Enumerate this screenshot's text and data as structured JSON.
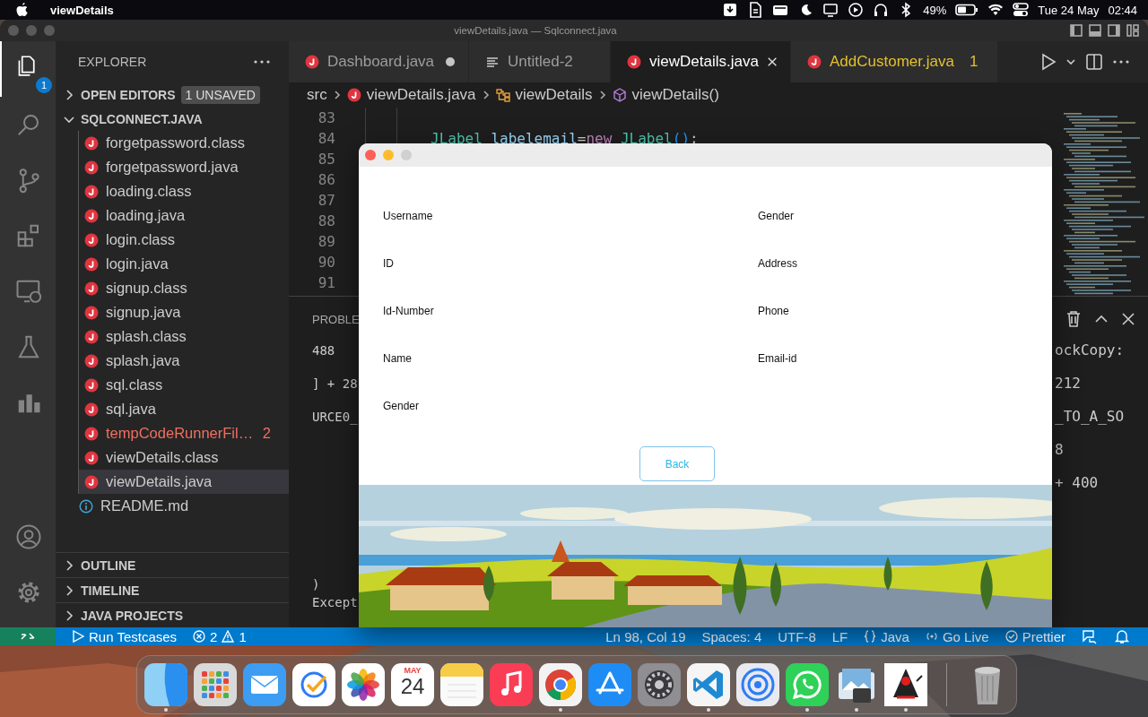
{
  "menu_bar": {
    "app": "viewDetails",
    "battery": "49%",
    "date": "Tue 24 May",
    "time": "02:44"
  },
  "window": {
    "title": "viewDetails.java — Sqlconnect.java"
  },
  "activity_bar": [
    {
      "kind": "explorer",
      "selected": true,
      "badge": "1"
    },
    {
      "kind": "search",
      "selected": false
    },
    {
      "kind": "source_control",
      "selected": false
    },
    {
      "kind": "extensions",
      "selected": false
    },
    {
      "kind": "remote",
      "selected": false
    },
    {
      "kind": "testing",
      "selected": false
    },
    {
      "kind": "chart",
      "selected": false
    }
  ],
  "activity_bar_bottom": [
    {
      "kind": "account"
    },
    {
      "kind": "settings"
    }
  ],
  "sidebar": {
    "title": "EXPLORER",
    "sections": [
      {
        "label": "OPEN EDITORS",
        "expanded": false,
        "badge": "1 UNSAVED"
      },
      {
        "label": "SQLCONNECT.JAVA",
        "expanded": true,
        "tree": [
          {
            "children": [
              {
                "label": "forgetpassword.class",
                "kind": "java",
                "selected": false
              },
              {
                "label": "forgetpassword.java",
                "kind": "java",
                "selected": false
              },
              {
                "label": "loading.class",
                "kind": "java",
                "selected": false
              },
              {
                "label": "loading.java",
                "kind": "java",
                "selected": false
              },
              {
                "label": "login.class",
                "kind": "java",
                "selected": false
              },
              {
                "label": "login.java",
                "kind": "java",
                "selected": false
              },
              {
                "label": "signup.class",
                "kind": "java",
                "selected": false
              },
              {
                "label": "signup.java",
                "kind": "java",
                "selected": false
              },
              {
                "label": "splash.class",
                "kind": "java",
                "selected": false
              },
              {
                "label": "splash.java",
                "kind": "java",
                "selected": false
              },
              {
                "label": "sql.class",
                "kind": "java",
                "selected": false
              },
              {
                "label": "sql.java",
                "kind": "java",
                "selected": false
              },
              {
                "label": "tempCodeRunnerFil…",
                "kind": "java",
                "selected": false,
                "has_errors": true,
                "problems": "2"
              },
              {
                "label": "viewDetails.class",
                "kind": "java",
                "selected": false
              },
              {
                "label": "viewDetails.java",
                "kind": "java",
                "selected": true
              }
            ]
          },
          {
            "label": "README.md",
            "kind": "info",
            "selected": false
          }
        ]
      }
    ],
    "bottom_sections": [
      {
        "label": "OUTLINE",
        "expanded": false
      },
      {
        "label": "TIMELINE",
        "expanded": false
      },
      {
        "label": "JAVA PROJECTS",
        "expanded": false
      }
    ]
  },
  "tabs": [
    {
      "label": "Dashboard.java",
      "kind": "java",
      "selected": false,
      "modified": true
    },
    {
      "label": "Untitled-2",
      "kind": "text",
      "selected": false,
      "modified": false
    },
    {
      "label": "viewDetails.java",
      "kind": "java",
      "selected": true,
      "modified": false
    },
    {
      "label": "AddCustomer.java",
      "kind": "java",
      "selected": false,
      "modified": false,
      "has_warnings": true,
      "problems": "1"
    }
  ],
  "breadcrumb": [
    {
      "label": "src",
      "kind": "folder"
    },
    {
      "label": "viewDetails.java",
      "kind": "java"
    },
    {
      "label": "viewDetails",
      "kind": "class"
    },
    {
      "label": "viewDetails()",
      "kind": "method"
    }
  ],
  "code": {
    "lines": [
      {
        "number": "83"
      },
      {
        "number": "84",
        "tokens": [
          {
            "text": "JLabel",
            "kind": "type"
          },
          {
            "text": " labelemail",
            "kind": "variable"
          },
          {
            "text": "=",
            "kind": "plain"
          },
          {
            "text": "new",
            "kind": "keyword"
          },
          {
            "text": " JLabel",
            "kind": "type"
          },
          {
            "text": "()",
            "kind": "bracket"
          },
          {
            "text": ";",
            "kind": "plain"
          }
        ]
      },
      {
        "number": "85"
      },
      {
        "number": "86"
      },
      {
        "number": "87"
      },
      {
        "number": "88"
      },
      {
        "number": "89"
      },
      {
        "number": "90"
      },
      {
        "number": "91"
      }
    ]
  },
  "panel": {
    "tab": "PROBLE",
    "left_lines": [
      "488",
      "] + 28",
      "URCE0_"
    ],
    "left_tail": [
      ")",
      "Except"
    ],
    "right_lines": [
      "ockCopy:",
      "212",
      "_TO_A_SO",
      "8",
      "+ 400"
    ]
  },
  "status_bar": {
    "run": "Run Testcases",
    "errors": "2",
    "warnings": "1",
    "items": [
      {
        "text": "Ln 98, Col 19",
        "kind": "plain"
      },
      {
        "text": "Spaces: 4",
        "kind": "plain"
      },
      {
        "text": "UTF-8",
        "kind": "plain"
      },
      {
        "text": "LF",
        "kind": "plain"
      },
      {
        "text": "Java",
        "kind": "braces"
      },
      {
        "text": "Go Live",
        "kind": "broadcast"
      },
      {
        "text": "Prettier",
        "kind": "check"
      }
    ]
  },
  "dialog": {
    "fields_left": [
      "Username",
      "ID",
      "Id-Number",
      "Name",
      "Gender"
    ],
    "fields_right": [
      "Gender",
      "Address",
      "Phone",
      "Email-id"
    ],
    "button": "Back",
    "banner": {
      "kind": "picture"
    }
  },
  "dock": [
    {
      "kind": "finder",
      "running": true
    },
    {
      "kind": "launchpad",
      "running": false
    },
    {
      "kind": "mail",
      "running": false
    },
    {
      "kind": "reminders",
      "running": false
    },
    {
      "kind": "photos",
      "running": false
    },
    {
      "kind": "calendar",
      "running": false,
      "month": "MAY",
      "day": "24"
    },
    {
      "kind": "notes",
      "running": false
    },
    {
      "kind": "music",
      "running": false
    },
    {
      "kind": "chrome",
      "running": true
    },
    {
      "kind": "appstore",
      "running": false
    },
    {
      "kind": "settings",
      "running": false
    },
    {
      "kind": "vscode",
      "running": true
    },
    {
      "kind": "airdrop",
      "running": false
    },
    {
      "kind": "whatsapp",
      "running": true
    },
    {
      "kind": "preview",
      "running": true
    },
    {
      "kind": "java",
      "running": true
    },
    {
      "kind": "trash",
      "running": false
    }
  ]
}
